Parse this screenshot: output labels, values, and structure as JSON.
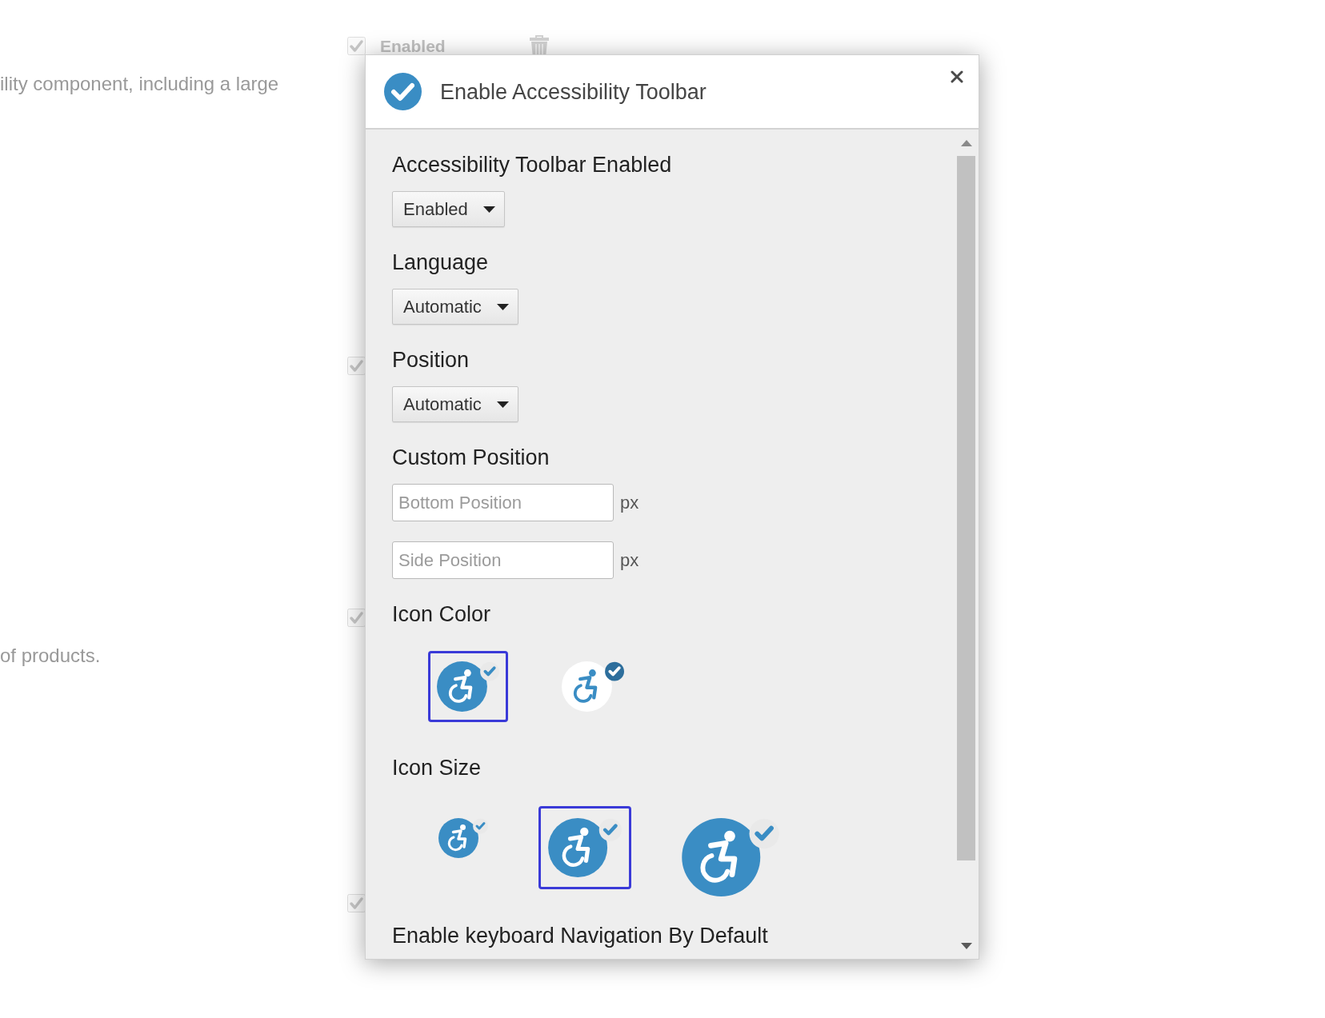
{
  "page": {
    "rows": [
      {
        "checked": true,
        "label": "Enabled",
        "description": "ility component, including a large"
      },
      {
        "checked": true
      },
      {
        "checked": true,
        "description": "of products."
      },
      {
        "checked": true
      }
    ]
  },
  "dialog": {
    "title": "Enable Accessibility Toolbar",
    "sections": [
      {
        "kind": "select",
        "label": "Accessibility Toolbar Enabled",
        "value": "Enabled"
      },
      {
        "kind": "select",
        "label": "Language",
        "value": "Automatic"
      },
      {
        "kind": "select",
        "label": "Position",
        "value": "Automatic"
      },
      {
        "kind": "inputs",
        "label": "Custom Position",
        "inputs": [
          {
            "placeholder": "Bottom Position",
            "unit": "px"
          },
          {
            "placeholder": "Side Position",
            "unit": "px"
          }
        ]
      },
      {
        "kind": "colors",
        "label": "Icon Color",
        "options": [
          {
            "color": "#3a8dc4",
            "selected": true
          },
          {
            "color": "#ffffff",
            "selected": false
          }
        ]
      },
      {
        "kind": "sizes",
        "label": "Icon Size",
        "options": [
          {
            "kind": "small",
            "selected": false
          },
          {
            "kind": "medium",
            "selected": true
          },
          {
            "kind": "large",
            "selected": false
          }
        ]
      },
      {
        "kind": "heading",
        "label": "Enable keyboard Navigation By Default"
      }
    ]
  }
}
